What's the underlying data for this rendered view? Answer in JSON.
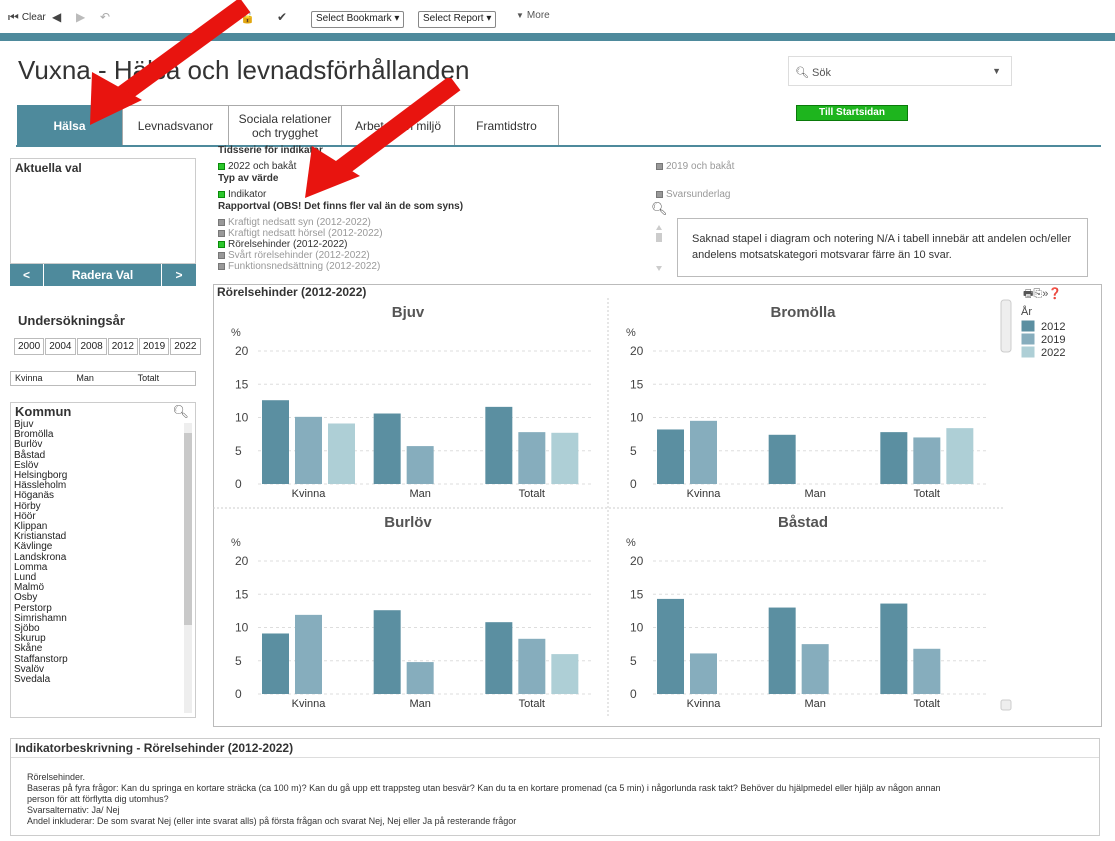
{
  "toolbar": {
    "clear": "Clear",
    "bookmark": "Select Bookmark",
    "report": "Select Report",
    "more": "More"
  },
  "title": "Vuxna - Hälsa och levnadsförhållanden",
  "search": {
    "placeholder": "Sök"
  },
  "home_button": "Till Startsidan",
  "tabs": [
    {
      "label": "Hälsa",
      "active": true
    },
    {
      "label": "Levnadsvanor"
    },
    {
      "label": "Sociala relationer och trygghet"
    },
    {
      "label": "Arbete och miljö"
    },
    {
      "label": "Framtidstro"
    }
  ],
  "aktuella_val": "Aktuella val",
  "radera": {
    "prev": "<",
    "label": "Radera Val",
    "next": ">"
  },
  "undersokningsar": {
    "title": "Undersökningsår",
    "years": [
      "2000",
      "2004",
      "2008",
      "2012",
      "2019",
      "2022"
    ]
  },
  "gender_options": [
    "Kvinna",
    "Man",
    "Totalt"
  ],
  "kommun": {
    "title": "Kommun",
    "items": [
      "Bjuv",
      "Bromölla",
      "Burlöv",
      "Båstad",
      "Eslöv",
      "Helsingborg",
      "Hässleholm",
      "Höganäs",
      "Hörby",
      "Höör",
      "Klippan",
      "Kristianstad",
      "Kävlinge",
      "Landskrona",
      "Lomma",
      "Lund",
      "Malmö",
      "Osby",
      "Perstorp",
      "Simrishamn",
      "Sjöbo",
      "Skurup",
      "Skåne",
      "Staffanstorp",
      "Svalöv",
      "Svedala"
    ]
  },
  "tidsserie": {
    "title": "Tidsserie för indikator",
    "options": [
      {
        "label": "2022 och bakåt",
        "selected": true
      },
      {
        "label": "2019 och bakåt",
        "selected": false
      }
    ]
  },
  "typ": {
    "title": "Typ av värde",
    "options": [
      {
        "label": "Indikator",
        "selected": true
      },
      {
        "label": "Svarsunderlag",
        "selected": false
      }
    ]
  },
  "rapportval": {
    "title": "Rapportval (OBS! Det finns fler val än de som syns)",
    "items": [
      {
        "label": "Kraftigt nedsatt syn (2012-2022)",
        "selected": false
      },
      {
        "label": "Kraftigt nedsatt hörsel (2012-2022)",
        "selected": false
      },
      {
        "label": "Rörelsehinder (2012-2022)",
        "selected": true
      },
      {
        "label": "Svårt rörelsehinder (2012-2022)",
        "selected": false
      },
      {
        "label": "Funktionsnedsättning (2012-2022)",
        "selected": false
      }
    ]
  },
  "info_text": "Saknad stapel i diagram och notering N/A i tabell innebär att andelen och/eller andelens motsatskategori motsvarar färre än 10 svar.",
  "chart_data": {
    "type": "bar",
    "title": "Rörelsehinder (2012-2022)",
    "ylabel": "%",
    "ylim": [
      0,
      20
    ],
    "yticks": [
      0,
      5,
      10,
      15,
      20
    ],
    "categories": [
      "Kvinna",
      "Man",
      "Totalt"
    ],
    "legend": {
      "title": "År",
      "entries": [
        "2012",
        "2019",
        "2022"
      ],
      "position": "right"
    },
    "series_colors": [
      "#5b8fa1",
      "#86adbd",
      "#aecfd6"
    ],
    "panels": [
      {
        "name": "Bjuv",
        "values": {
          "2012": [
            12.6,
            10.6,
            11.6
          ],
          "2019": [
            10.1,
            5.7,
            7.8
          ],
          "2022": [
            9.1,
            null,
            7.7
          ]
        }
      },
      {
        "name": "Bromölla",
        "values": {
          "2012": [
            8.2,
            7.4,
            7.8
          ],
          "2019": [
            9.5,
            null,
            7.0
          ],
          "2022": [
            null,
            null,
            8.4
          ]
        }
      },
      {
        "name": "Burlöv",
        "values": {
          "2012": [
            9.1,
            12.6,
            10.8
          ],
          "2019": [
            11.9,
            4.8,
            8.3
          ],
          "2022": [
            null,
            null,
            6.0
          ]
        }
      },
      {
        "name": "Båstad",
        "values": {
          "2012": [
            14.3,
            13.0,
            13.6
          ],
          "2019": [
            6.1,
            7.5,
            6.8
          ],
          "2022": [
            null,
            null,
            null
          ]
        }
      }
    ]
  },
  "description": {
    "title": "Indikatorbeskrivning - Rörelsehinder (2012-2022)",
    "lines": [
      "Rörelsehinder.",
      "Baseras på fyra frågor: Kan du springa en kortare sträcka (ca 100 m)? Kan du gå upp ett trappsteg utan besvär? Kan du ta en kortare promenad (ca 5 min) i någorlunda rask takt? Behöver du hjälpmedel eller hjälp av någon annan",
      "person för att förflytta dig utomhus?",
      "Svarsalternativ: Ja/ Nej",
      "Andel inkluderar: De som svarat Nej (eller inte svarat alls) på första frågan och svarat Nej, Nej eller Ja på resterande frågor"
    ]
  }
}
